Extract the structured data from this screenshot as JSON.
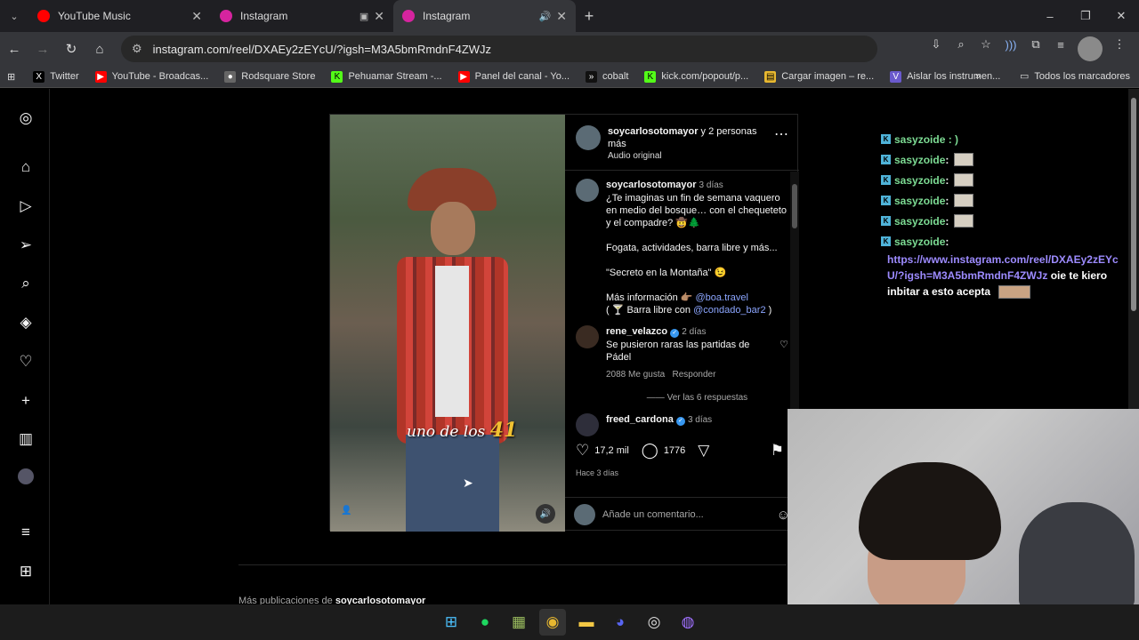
{
  "tabs": [
    {
      "label": "YouTube Music",
      "color": "#ff0000"
    },
    {
      "label": "Instagram",
      "color": "#d6249f"
    },
    {
      "label": "Instagram",
      "color": "#d6249f",
      "active": true
    }
  ],
  "window_controls": [
    "–",
    "❐",
    "✕"
  ],
  "url": "instagram.com/reel/DXAEy2zEYcU/?igsh=M3A5bmRmdnF4ZWJz",
  "bookmarks": [
    {
      "label": "Twitter",
      "icon": "X",
      "color": "#000000"
    },
    {
      "label": "YouTube - Broadcas...",
      "icon": "▶",
      "color": "#ff0000"
    },
    {
      "label": "Rodsquare Store",
      "icon": "●",
      "color": "#666666"
    },
    {
      "label": "Pehuamar Stream -...",
      "icon": "K",
      "color": "#53fc18"
    },
    {
      "label": "Panel del canal - Yo...",
      "icon": "▶",
      "color": "#ff0000"
    },
    {
      "label": "cobalt",
      "icon": ">>",
      "color": "#111111"
    },
    {
      "label": "kick.com/popout/p...",
      "icon": "K",
      "color": "#53fc18"
    },
    {
      "label": "Cargar imagen – re...",
      "icon": "▤",
      "color": "#e8b830"
    },
    {
      "label": "Aislar los instrumen...",
      "icon": "V",
      "color": "#6a5acd"
    }
  ],
  "bookmarks_all": "Todos los marcadores",
  "post": {
    "header_user": "soycarlosotomayor",
    "header_rest": " y 2 personas más",
    "header_sub": "Audio original",
    "caption_user": "soycarlosotomayor",
    "caption_time": "3 días",
    "caption_line1": "¿Te imaginas un fin de semana vaquero en medio del bosque… con el chequeteto y el compadre? 🤠🌲",
    "caption_line2": "Fogata, actividades, barra libre y más...",
    "caption_line3": "\"Secreto en la Montaña\" 😉",
    "caption_line4_a": "Más información 👉🏽 ",
    "caption_line4_link": "@boa.travel",
    "caption_line5_a": "( 🍸 Barra libre con ",
    "caption_line5_link": "@condado_bar2",
    "caption_line5_b": " )",
    "comment1_user": "rene_velazco",
    "comment1_time": "2 días",
    "comment1_text": "Se pusieron raras las partidas de Pádel",
    "comment1_likes": "2088 Me gusta",
    "comment1_reply": "Responder",
    "comment1_more": "Ver las 6 respuestas",
    "comment2_user": "freed_cardona",
    "comment2_time": "3 días",
    "likes": "17,2 mil",
    "comments": "1776",
    "date": "Hace 3 días",
    "add_comment_placeholder": "Añade un comentario...",
    "video_overlay_text": "uno de los",
    "video_overlay_num": "41"
  },
  "more_pubs_prefix": "Más publicaciones de ",
  "more_pubs_user": "soycarlosotomayor",
  "chat": {
    "user": "sasyzoide",
    "sep": " :",
    "partial_text": "sasyzoide : )",
    "url": "https://www.instagram.com/reel/DXAEy2zEYcU/?igsh=M3A5bmRmdnF4ZWJz",
    "message": "oie te kiero inbitar a esto acepta"
  },
  "taskbar_icons": [
    "windows-start-icon",
    "spotify-icon",
    "app-icon",
    "chrome-icon",
    "file-explorer-icon",
    "discord-icon",
    "obs-icon",
    "messenger-icon"
  ]
}
